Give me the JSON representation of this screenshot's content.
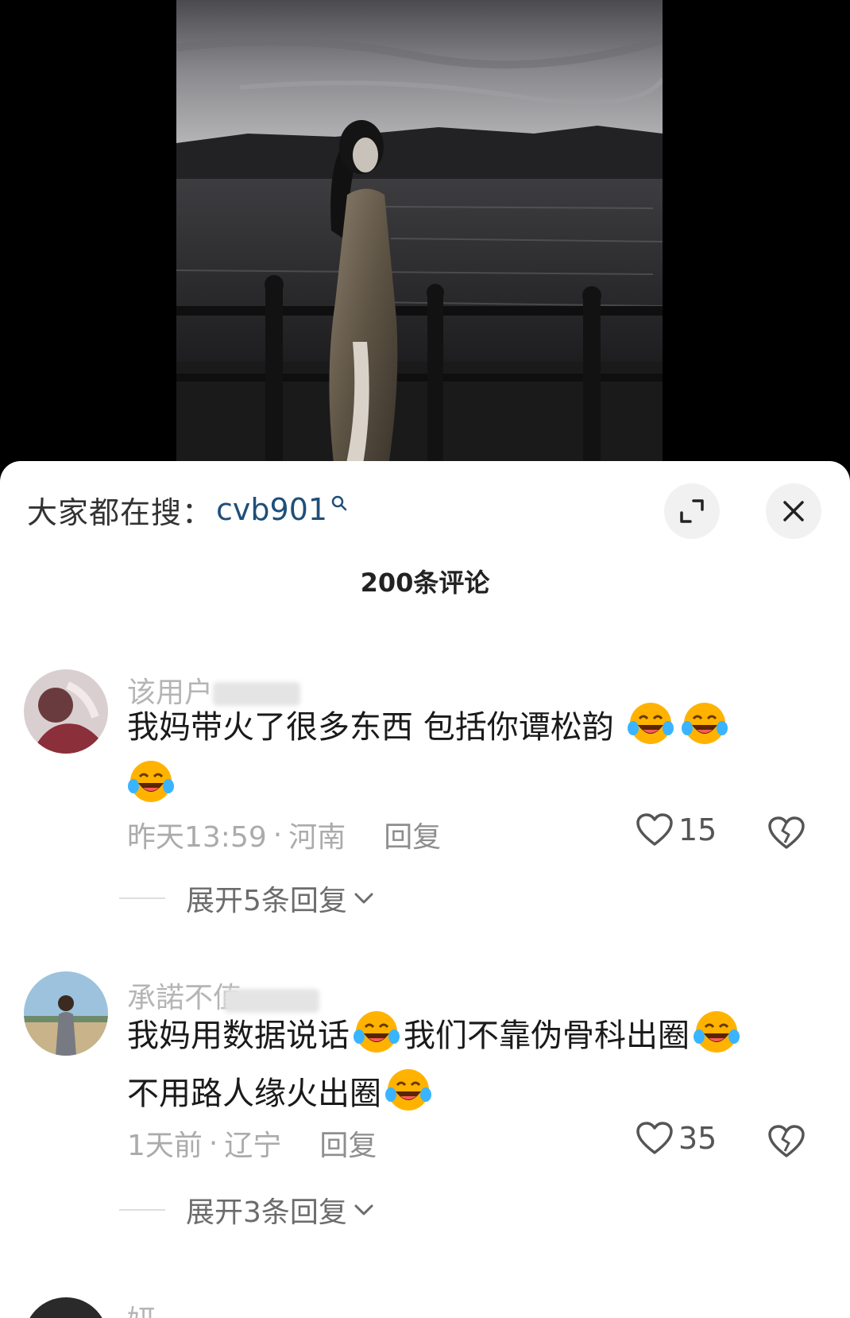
{
  "search": {
    "prefix": "大家都在搜：",
    "term": "cvb901"
  },
  "comments_count": "200条评论",
  "comments": [
    {
      "username": "该用户",
      "text": "我妈带火了很多东西 包括你谭松韵",
      "emoji": [
        "laugh-cry-emoji",
        "laugh-cry-emoji",
        "laugh-cry-emoji"
      ],
      "time": "昨天13:59",
      "location": "河南",
      "reply_label": "回复",
      "likes": "15",
      "expand_label": "展开5条回复"
    },
    {
      "username": "承諾不值",
      "text_parts": [
        "我妈用数据说话",
        "我们不靠伪骨科出圈",
        "不用路人缘火出圈"
      ],
      "time": "1天前",
      "location": "辽宁",
      "reply_label": "回复",
      "likes": "35",
      "expand_label": "展开3条回复"
    },
    {
      "username": "妍"
    }
  ],
  "colors": {
    "search_term": "#1f4f7a",
    "sheet_bg": "#ffffff",
    "button_bg": "#f1f1f2"
  }
}
